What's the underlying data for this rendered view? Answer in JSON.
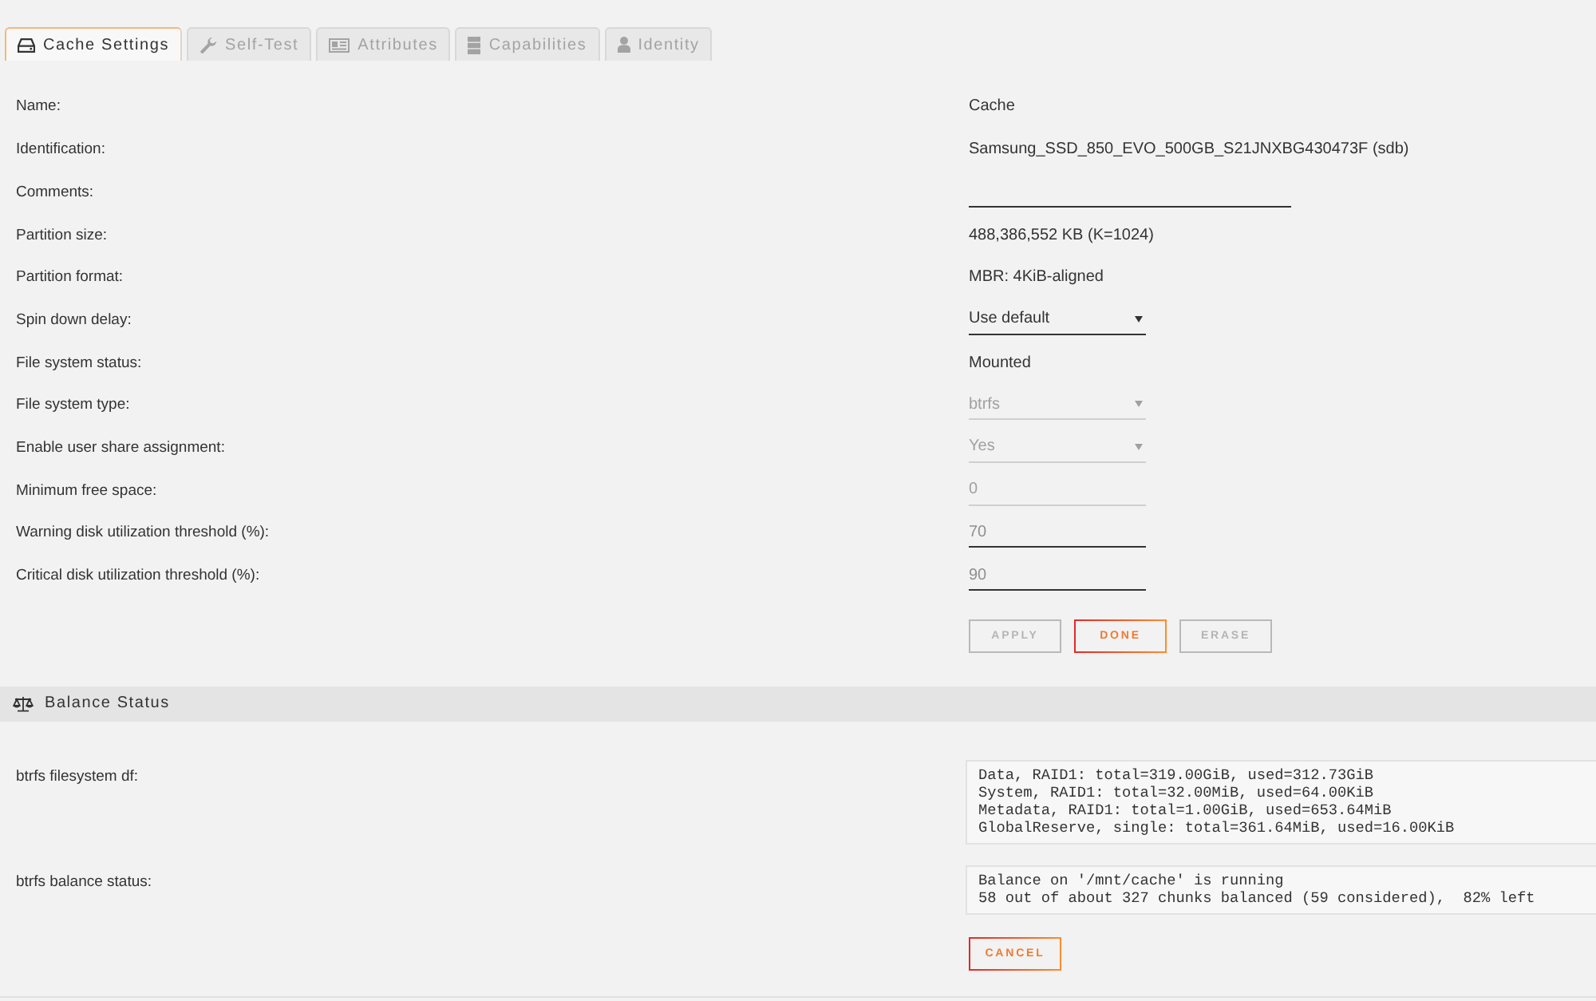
{
  "tabs": [
    {
      "label": "Cache Settings",
      "selected": true
    },
    {
      "label": "Self-Test",
      "selected": false
    },
    {
      "label": "Attributes",
      "selected": false
    },
    {
      "label": "Capabilities",
      "selected": false
    },
    {
      "label": "Identity",
      "selected": false
    }
  ],
  "settings": {
    "rows": [
      {
        "label": "Name:",
        "kind": "text",
        "value": "Cache"
      },
      {
        "label": "Identification:",
        "kind": "text",
        "value": "Samsung_SSD_850_EVO_500GB_S21JNXBG430473F (sdb)"
      },
      {
        "label": "Comments:",
        "kind": "text_input",
        "disabled": false
      },
      {
        "label": "Partition size:",
        "kind": "text",
        "value": "488,386,552 KB (K=1024)"
      },
      {
        "label": "Partition format:",
        "kind": "text",
        "value": "MBR: 4KiB-aligned"
      },
      {
        "label": "Spin down delay:",
        "kind": "select",
        "value": "Use default",
        "disabled": false
      },
      {
        "label": "File system status:",
        "kind": "text",
        "value": "Mounted"
      },
      {
        "label": "File system type:",
        "kind": "select",
        "value": "btrfs",
        "disabled": true
      },
      {
        "label": "Enable user share assignment:",
        "kind": "select",
        "value": "Yes",
        "disabled": true
      },
      {
        "label": "Minimum free space:",
        "kind": "number_input",
        "value": "0",
        "disabled": true
      },
      {
        "label": "Warning disk utilization threshold (%):",
        "kind": "number_input",
        "placeholder": "70",
        "disabled": false
      },
      {
        "label": "Critical disk utilization threshold (%):",
        "kind": "number_input",
        "placeholder": "90",
        "disabled": false
      }
    ],
    "buttons": [
      {
        "label": "APPLY",
        "disabled": true
      },
      {
        "label": "DONE",
        "disabled": false
      },
      {
        "label": "ERASE",
        "disabled": true
      }
    ]
  },
  "balance_status": {
    "title": "Balance Status",
    "rows": [
      {
        "label": "btrfs filesystem df:",
        "lines": [
          "Data, RAID1: total=319.00GiB, used=312.73GiB",
          "System, RAID1: total=32.00MiB, used=64.00KiB",
          "Metadata, RAID1: total=1.00GiB, used=653.64MiB",
          "GlobalReserve, single: total=361.64MiB, used=16.00KiB"
        ]
      },
      {
        "label": "btrfs balance status:",
        "lines": [
          "Balance on '/mnt/cache' is running",
          "58 out of about 327 chunks balanced (59 considered),  82% left"
        ]
      }
    ],
    "buttons": [
      {
        "label": "CANCEL",
        "disabled": false
      }
    ]
  }
}
